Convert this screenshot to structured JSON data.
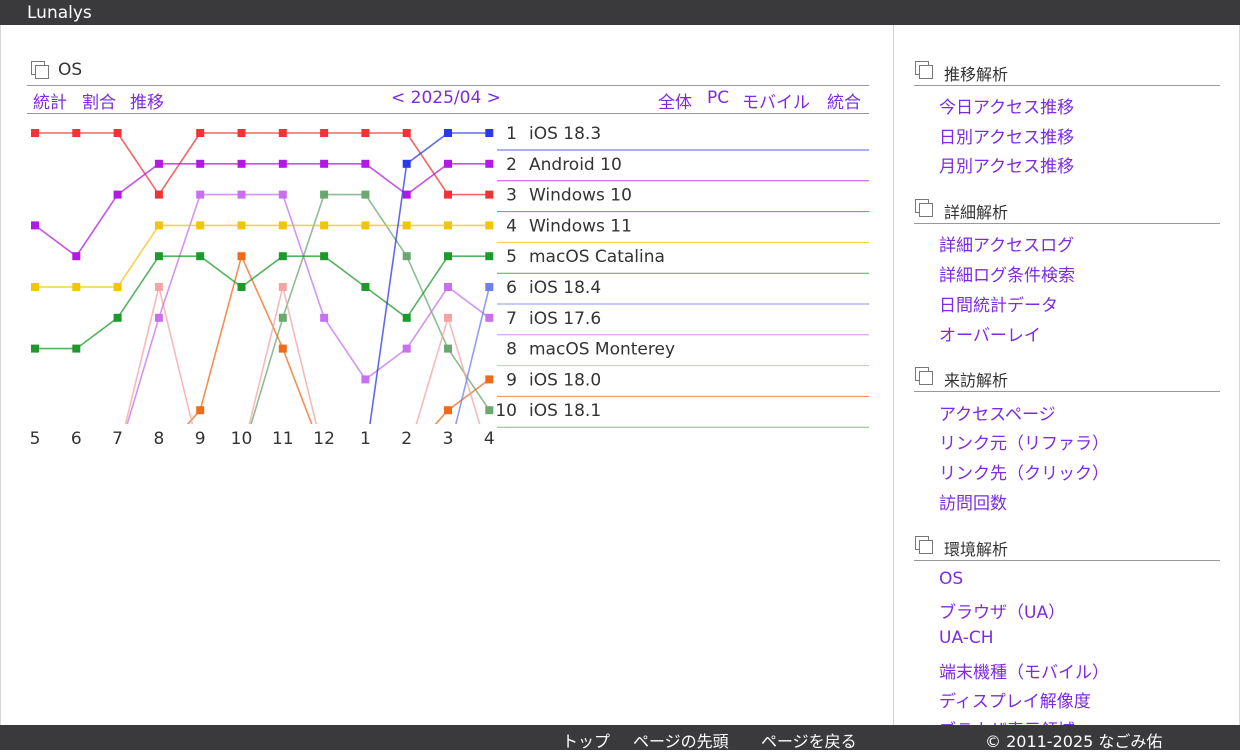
{
  "app": {
    "brand": "Lunalys"
  },
  "main": {
    "title": "OS",
    "subnav": {
      "stats": "統計",
      "ratio": "割合",
      "trend": "推移"
    },
    "period": "< 2025/04 >",
    "filters": {
      "all": "全体",
      "pc": "PC",
      "mobile": "モバイル",
      "combined": "統合"
    }
  },
  "chart_data": {
    "type": "line",
    "title": "",
    "xlabel": "",
    "ylabel": "",
    "x": [
      "5",
      "6",
      "7",
      "8",
      "9",
      "10",
      "11",
      "12",
      "1",
      "2",
      "3",
      "4"
    ],
    "y_axis": "rank (1 = top)",
    "series": [
      {
        "name": "iOS 18.3",
        "rank": 1,
        "color": "#2a3ae8",
        "values": [
          null,
          null,
          null,
          null,
          null,
          null,
          null,
          null,
          null,
          2,
          1,
          1
        ]
      },
      {
        "name": "Android 10",
        "rank": 2,
        "color": "#b418e6",
        "values": [
          4,
          5,
          3,
          2,
          2,
          2,
          2,
          2,
          2,
          3,
          2,
          2
        ]
      },
      {
        "name": "Windows 10",
        "rank": 3,
        "color": "#ee3434",
        "values": [
          1,
          1,
          1,
          3,
          1,
          1,
          1,
          1,
          1,
          1,
          3,
          3
        ]
      },
      {
        "name": "Windows 11",
        "rank": 4,
        "color": "#f2c40a",
        "values": [
          6,
          6,
          6,
          4,
          4,
          4,
          4,
          4,
          4,
          4,
          4,
          4
        ]
      },
      {
        "name": "macOS Catalina",
        "rank": 5,
        "color": "#1c9a2c",
        "values": [
          8,
          8,
          7,
          5,
          5,
          6,
          5,
          5,
          6,
          7,
          5,
          5
        ]
      },
      {
        "name": "iOS 18.4",
        "rank": 6,
        "color": "#6d80e8",
        "values": [
          null,
          null,
          null,
          null,
          null,
          null,
          null,
          null,
          null,
          null,
          null,
          6
        ]
      },
      {
        "name": "iOS 17.6",
        "rank": 7,
        "color": "#c870ee",
        "values": [
          null,
          null,
          null,
          7,
          3,
          3,
          3,
          7,
          9,
          8,
          6,
          7
        ]
      },
      {
        "name": "macOS Monterey",
        "rank": 8,
        "color": "#f4a4a4",
        "values": [
          null,
          null,
          null,
          6,
          null,
          null,
          6,
          null,
          null,
          null,
          7,
          null
        ]
      },
      {
        "name": "iOS 18.0",
        "rank": 9,
        "color": "#f06a1a",
        "values": [
          null,
          null,
          null,
          null,
          10,
          5,
          8,
          null,
          null,
          null,
          10,
          9
        ]
      },
      {
        "name": "iOS 18.1",
        "rank": 10,
        "color": "#6aa870",
        "values": [
          null,
          null,
          null,
          null,
          null,
          null,
          7,
          3,
          3,
          5,
          8,
          10
        ]
      }
    ]
  },
  "sidebar": {
    "sections": [
      {
        "heading": "推移解析",
        "items": [
          "今日アクセス推移",
          "日別アクセス推移",
          "月別アクセス推移"
        ]
      },
      {
        "heading": "詳細解析",
        "items": [
          "詳細アクセスログ",
          "詳細ログ条件検索",
          "日間統計データ",
          "オーバーレイ"
        ]
      },
      {
        "heading": "来訪解析",
        "items": [
          "アクセスページ",
          "リンク元（リファラ）",
          "リンク先（クリック）",
          "訪問回数"
        ]
      },
      {
        "heading": "環境解析",
        "items": [
          "OS",
          "ブラウザ（UA）",
          "UA-CH",
          "端末機種（モバイル）",
          "ディスプレイ解像度",
          "ブラウザ表示領域"
        ]
      }
    ]
  },
  "footer": {
    "links": [
      "トップ",
      "ページの先頭",
      "ページを戻る"
    ],
    "copyright": "© 2011-2025 なごみ佑"
  }
}
